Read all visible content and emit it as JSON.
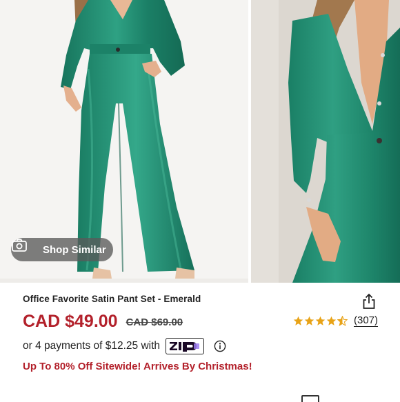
{
  "gallery": {
    "shop_similar_label": "Shop Similar",
    "camera_icon": "camera-icon"
  },
  "product": {
    "title": "Office Favorite Satin Pant Set - Emerald",
    "price": "CAD $49.00",
    "original_price": "CAD $69.00",
    "rating": 4.5,
    "review_count": "(307)",
    "share_icon": "share-icon"
  },
  "payments": {
    "text": "or 4 payments of $12.25 with",
    "provider_logo": "Zip",
    "info_icon": "info-icon"
  },
  "promo": {
    "text": "Up To 80% Off Sitewide! Arrives By Christmas!"
  },
  "colors": {
    "price_red": "#b3212b",
    "star_gold": "#e8a317",
    "garment_emerald": "#1f8a6e",
    "zip_purple": "#9d7cf0"
  }
}
